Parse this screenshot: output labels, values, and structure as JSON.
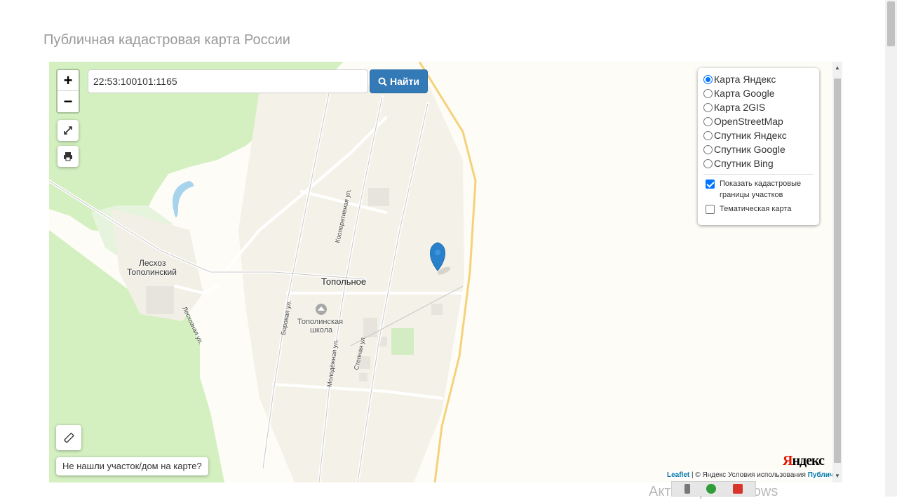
{
  "page": {
    "title": "Публичная кадастровая карта России"
  },
  "search": {
    "value": "22:53:100101:1165",
    "button_label": "Найти"
  },
  "zoom": {
    "in_label": "+",
    "out_label": "−"
  },
  "layers": {
    "base": [
      {
        "label": "Карта Яндекс",
        "selected": true
      },
      {
        "label": "Карта Google",
        "selected": false
      },
      {
        "label": "Карта 2GIS",
        "selected": false
      },
      {
        "label": "OpenStreetMap",
        "selected": false
      },
      {
        "label": "Спутник Яндекс",
        "selected": false
      },
      {
        "label": "Спутник Google",
        "selected": false
      },
      {
        "label": "Спутник Bing",
        "selected": false
      }
    ],
    "overlays": [
      {
        "label": "Показать кадастровые границы участков",
        "checked": true
      },
      {
        "label": "Тематическая карта",
        "checked": false
      }
    ]
  },
  "map_labels": {
    "village": "Топольное",
    "forestry_line1": "Лесхоз",
    "forestry_line2": "Тополинский",
    "school_line1": "Тополинская",
    "school_line2": "школа",
    "street_kooperativnaya": "Кооперативная ул.",
    "street_borovaya": "Боровая ул.",
    "street_molodezhnaya": "Молодёжная ул.",
    "street_stepnaya": "Степная ул.",
    "street_leskhoznaya": "Лесхозная ул."
  },
  "not_found_button": "Не нашли участок/дом на карте?",
  "attribution": {
    "leaflet": "Leaflet",
    "yandex_terms": "© Яндекс Условия использования",
    "cadastral": "Публичная кадастровая карта, ©"
  },
  "yandex_logo": {
    "first": "Я",
    "rest": "ндекс"
  },
  "os_watermark": "Активация Windows",
  "colors": {
    "accent": "#337ab7",
    "forest": "#d4f0c0",
    "marker": "#2a81cb"
  }
}
